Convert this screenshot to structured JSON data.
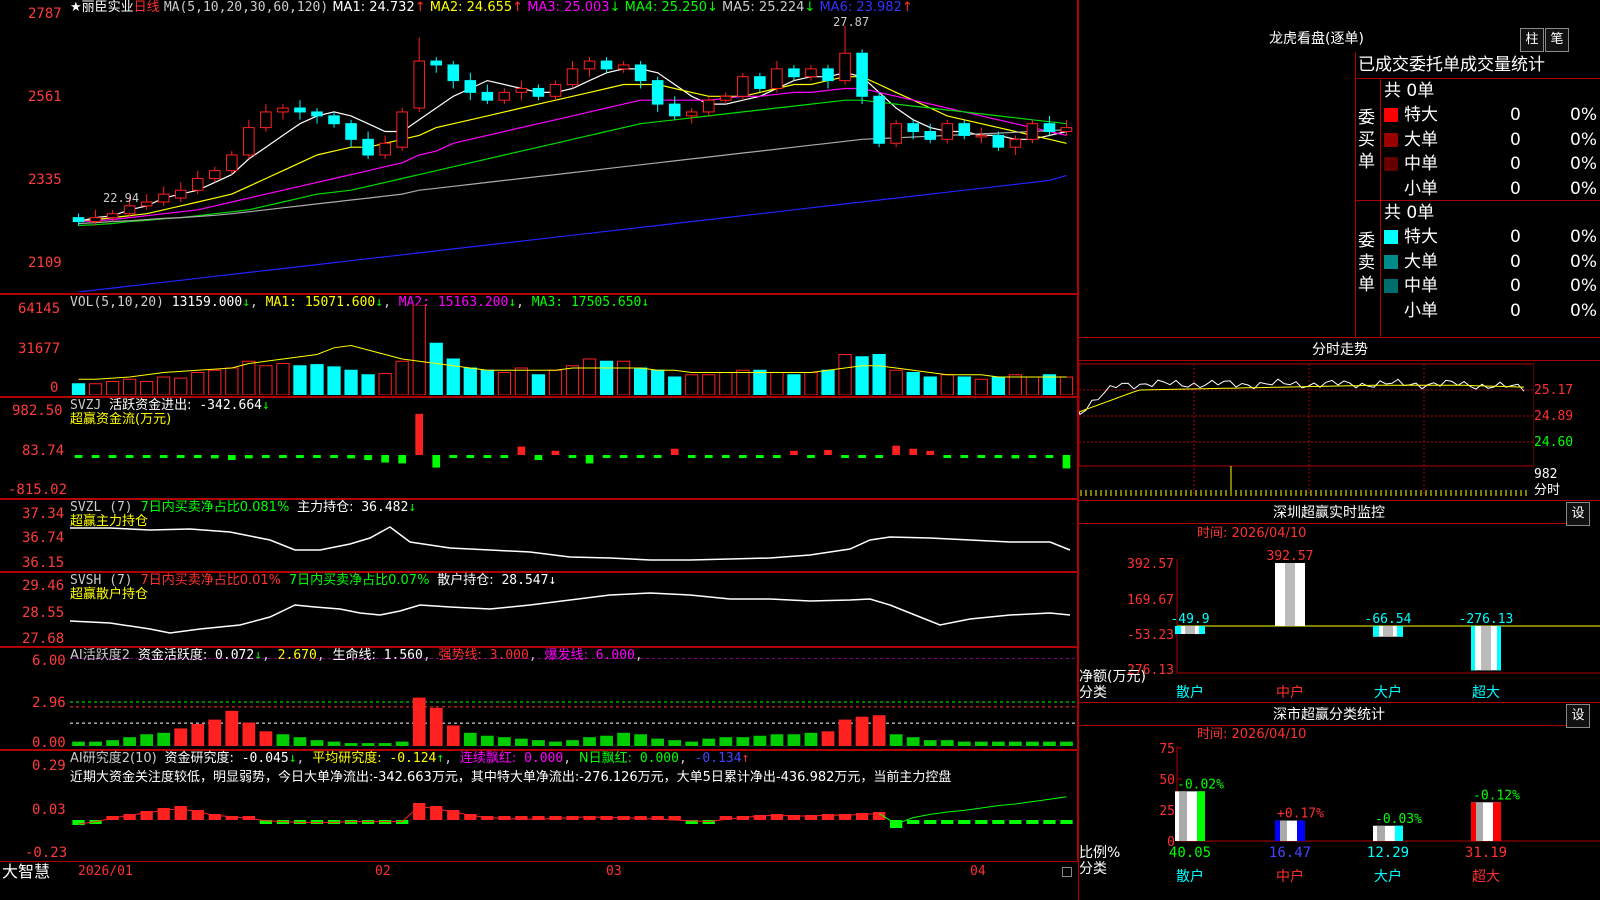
{
  "stock": {
    "name": "丽臣实业",
    "period": "日线",
    "star": "★"
  },
  "kline": {
    "axis": [
      "2787",
      "2561",
      "2335",
      "2109"
    ],
    "ma_label": "MA(5,10,20,30,60,120)",
    "ma": [
      {
        "name": "MA1:",
        "value": "24.732",
        "arrow": "↑",
        "color": "#ffffff"
      },
      {
        "name": "MA2:",
        "value": "24.655",
        "arrow": "↑",
        "color": "#ffff00"
      },
      {
        "name": "MA3:",
        "value": "25.003",
        "arrow": "↓",
        "color": "#ff00ff"
      },
      {
        "name": "MA4:",
        "value": "25.250",
        "arrow": "↓",
        "color": "#00ff00"
      },
      {
        "name": "MA5:",
        "value": "25.224",
        "arrow": "↓",
        "color": "#cccccc"
      },
      {
        "name": "MA6:",
        "value": "23.982",
        "arrow": "↑",
        "color": "#3333ff"
      }
    ],
    "high_label": "27.87",
    "low_label": "22.94",
    "colors": {
      "up": "#ff2020",
      "down": "#00ffff"
    },
    "candles": [
      [
        22.9,
        22.8,
        23.0,
        22.7
      ],
      [
        22.8,
        22.9,
        23.1,
        22.7
      ],
      [
        22.9,
        23.0,
        23.1,
        22.8
      ],
      [
        23.0,
        23.2,
        23.4,
        22.9
      ],
      [
        23.2,
        23.3,
        23.5,
        23.1
      ],
      [
        23.3,
        23.5,
        23.7,
        23.2
      ],
      [
        23.4,
        23.6,
        23.8,
        23.3
      ],
      [
        23.6,
        23.9,
        24.1,
        23.5
      ],
      [
        23.9,
        24.1,
        24.2,
        23.8
      ],
      [
        24.1,
        24.5,
        24.6,
        24.0
      ],
      [
        24.5,
        25.2,
        25.4,
        24.4
      ],
      [
        25.2,
        25.6,
        25.8,
        25.1
      ],
      [
        25.6,
        25.7,
        25.8,
        25.4
      ],
      [
        25.7,
        25.6,
        25.9,
        25.4
      ],
      [
        25.6,
        25.5,
        25.7,
        25.3
      ],
      [
        25.5,
        25.3,
        25.6,
        25.2
      ],
      [
        25.3,
        24.9,
        25.4,
        24.7
      ],
      [
        24.9,
        24.5,
        25.1,
        24.4
      ],
      [
        24.5,
        24.8,
        25.0,
        24.4
      ],
      [
        24.7,
        25.6,
        25.7,
        24.6
      ],
      [
        25.7,
        26.9,
        27.5,
        25.6
      ],
      [
        26.9,
        26.8,
        27.0,
        26.6
      ],
      [
        26.8,
        26.4,
        26.9,
        26.2
      ],
      [
        26.4,
        26.1,
        26.6,
        25.9
      ],
      [
        26.1,
        25.9,
        26.3,
        25.8
      ],
      [
        25.9,
        26.1,
        26.2,
        25.8
      ],
      [
        26.1,
        26.2,
        26.4,
        25.9
      ],
      [
        26.2,
        26.0,
        26.3,
        25.9
      ],
      [
        26.0,
        26.3,
        26.4,
        25.9
      ],
      [
        26.3,
        26.7,
        26.9,
        26.2
      ],
      [
        26.7,
        26.9,
        27.0,
        26.5
      ],
      [
        26.9,
        26.7,
        27.0,
        26.6
      ],
      [
        26.7,
        26.8,
        26.9,
        26.6
      ],
      [
        26.8,
        26.4,
        26.9,
        26.2
      ],
      [
        26.4,
        25.8,
        26.5,
        25.6
      ],
      [
        25.8,
        25.5,
        26.0,
        25.4
      ],
      [
        25.5,
        25.6,
        25.7,
        25.3
      ],
      [
        25.6,
        25.9,
        26.0,
        25.5
      ],
      [
        25.9,
        26.0,
        26.1,
        25.8
      ],
      [
        26.0,
        26.5,
        26.6,
        25.9
      ],
      [
        26.5,
        26.2,
        26.6,
        26.1
      ],
      [
        26.2,
        26.7,
        26.9,
        26.1
      ],
      [
        26.7,
        26.5,
        26.8,
        26.4
      ],
      [
        26.5,
        26.7,
        26.8,
        26.4
      ],
      [
        26.7,
        26.4,
        26.8,
        26.2
      ],
      [
        26.4,
        27.1,
        27.8,
        26.3
      ],
      [
        27.1,
        26.0,
        27.2,
        25.8
      ],
      [
        26.0,
        24.8,
        26.1,
        24.7
      ],
      [
        24.8,
        25.3,
        25.4,
        24.7
      ],
      [
        25.3,
        25.1,
        25.4,
        24.9
      ],
      [
        25.1,
        24.9,
        25.3,
        24.8
      ],
      [
        24.9,
        25.3,
        25.4,
        24.8
      ],
      [
        25.3,
        25.0,
        25.4,
        24.9
      ],
      [
        25.0,
        25.0,
        25.2,
        24.8
      ],
      [
        25.0,
        24.7,
        25.1,
        24.6
      ],
      [
        24.7,
        24.9,
        25.0,
        24.5
      ],
      [
        24.9,
        25.3,
        25.4,
        24.8
      ],
      [
        25.3,
        25.1,
        25.5,
        25.0
      ],
      [
        25.1,
        25.2,
        25.4,
        25.0
      ]
    ],
    "ma_lines": [
      {
        "color": "#ffffff",
        "v": [
          22.8,
          22.9,
          22.95,
          23.1,
          23.2,
          23.4,
          23.5,
          23.6,
          23.8,
          24.0,
          24.4,
          24.7,
          25.0,
          25.3,
          25.5,
          25.6,
          25.5,
          25.3,
          25.1,
          25.1,
          25.4,
          25.7,
          26.0,
          26.2,
          26.4,
          26.3,
          26.2,
          26.1,
          26.1,
          26.2,
          26.4,
          26.6,
          26.7,
          26.7,
          26.6,
          26.3,
          26.0,
          25.8,
          25.8,
          25.9,
          26.0,
          26.2,
          26.4,
          26.5,
          26.5,
          26.6,
          26.5,
          26.1,
          25.7,
          25.4,
          25.2,
          25.1,
          25.1,
          25.0,
          25.0,
          24.9,
          24.9,
          25.0,
          25.1
        ]
      },
      {
        "color": "#ffff00",
        "v": [
          22.8,
          22.85,
          22.9,
          22.95,
          23.0,
          23.1,
          23.2,
          23.3,
          23.4,
          23.5,
          23.7,
          23.9,
          24.1,
          24.3,
          24.5,
          24.6,
          24.7,
          24.7,
          24.8,
          24.9,
          25.0,
          25.2,
          25.3,
          25.4,
          25.5,
          25.6,
          25.7,
          25.8,
          25.9,
          26.0,
          26.1,
          26.2,
          26.3,
          26.3,
          26.3,
          26.2,
          26.1,
          26.0,
          26.0,
          26.0,
          26.1,
          26.2,
          26.3,
          26.3,
          26.4,
          26.5,
          26.5,
          26.3,
          26.1,
          25.9,
          25.7,
          25.5,
          25.4,
          25.3,
          25.2,
          25.1,
          25.0,
          24.9,
          24.8
        ]
      },
      {
        "color": "#ff00ff",
        "v": [
          22.8,
          22.82,
          22.85,
          22.9,
          22.95,
          23.0,
          23.05,
          23.1,
          23.2,
          23.3,
          23.4,
          23.5,
          23.6,
          23.7,
          23.8,
          23.9,
          24.0,
          24.1,
          24.2,
          24.3,
          24.5,
          24.6,
          24.8,
          24.9,
          25.0,
          25.1,
          25.2,
          25.3,
          25.4,
          25.5,
          25.6,
          25.7,
          25.8,
          25.9,
          25.9,
          25.9,
          25.9,
          25.9,
          25.95,
          26.0,
          26.0,
          26.05,
          26.1,
          26.1,
          26.15,
          26.2,
          26.2,
          26.1,
          26.0,
          25.9,
          25.8,
          25.7,
          25.6,
          25.5,
          25.4,
          25.3,
          25.2,
          25.1,
          25.0
        ]
      },
      {
        "color": "#00dd00",
        "v": [
          22.7,
          22.72,
          22.75,
          22.8,
          22.83,
          22.87,
          22.9,
          22.95,
          23.0,
          23.05,
          23.1,
          23.2,
          23.3,
          23.4,
          23.5,
          23.55,
          23.6,
          23.7,
          23.8,
          23.9,
          24.0,
          24.1,
          24.2,
          24.3,
          24.4,
          24.5,
          24.6,
          24.7,
          24.8,
          24.9,
          25.0,
          25.1,
          25.2,
          25.3,
          25.35,
          25.4,
          25.45,
          25.5,
          25.55,
          25.6,
          25.65,
          25.7,
          25.75,
          25.8,
          25.85,
          25.9,
          25.9,
          25.85,
          25.8,
          25.75,
          25.7,
          25.65,
          25.6,
          25.55,
          25.5,
          25.45,
          25.4,
          25.35,
          25.3
        ]
      },
      {
        "color": "#aaaaaa",
        "v": [
          22.75,
          22.77,
          22.8,
          22.82,
          22.85,
          22.88,
          22.9,
          22.93,
          22.96,
          23.0,
          23.05,
          23.1,
          23.15,
          23.2,
          23.25,
          23.3,
          23.35,
          23.4,
          23.45,
          23.5,
          23.6,
          23.65,
          23.7,
          23.75,
          23.8,
          23.85,
          23.9,
          23.95,
          24.0,
          24.05,
          24.1,
          24.15,
          24.2,
          24.25,
          24.3,
          24.35,
          24.4,
          24.45,
          24.5,
          24.55,
          24.6,
          24.65,
          24.7,
          24.75,
          24.8,
          24.85,
          24.9,
          24.92,
          24.94,
          24.96,
          24.98,
          25.0,
          25.02,
          25.04,
          25.06,
          25.08,
          25.1,
          25.12,
          25.15
        ]
      },
      {
        "color": "#2222ff",
        "v": [
          21.0,
          21.05,
          21.1,
          21.15,
          21.2,
          21.25,
          21.3,
          21.35,
          21.4,
          21.45,
          21.5,
          21.55,
          21.6,
          21.65,
          21.7,
          21.75,
          21.8,
          21.85,
          21.9,
          21.95,
          22.0,
          22.05,
          22.1,
          22.15,
          22.2,
          22.25,
          22.3,
          22.35,
          22.4,
          22.45,
          22.5,
          22.55,
          22.6,
          22.65,
          22.7,
          22.75,
          22.8,
          22.85,
          22.9,
          22.95,
          23.0,
          23.05,
          23.1,
          23.15,
          23.2,
          23.25,
          23.3,
          23.35,
          23.4,
          23.45,
          23.5,
          23.55,
          23.6,
          23.65,
          23.7,
          23.75,
          23.8,
          23.85,
          23.98
        ]
      }
    ]
  },
  "vol": {
    "axis": [
      "64145",
      "31677",
      "0"
    ],
    "label": "VOL(5,10,20)",
    "items": [
      {
        "t": "13159.000",
        "a": "↓",
        "c": "#ffffff"
      },
      {
        "t": "MA1: 15071.600",
        "a": "↓",
        "c": "#ffff00"
      },
      {
        "t": "MA2: 15163.200",
        "a": "↓",
        "c": "#ff00ff"
      },
      {
        "t": "MA3: 17505.650",
        "a": "↓",
        "c": "#00ff00"
      }
    ],
    "bars": [
      10,
      10,
      12,
      14,
      12,
      16,
      15,
      20,
      22,
      24,
      30,
      26,
      28,
      26,
      27,
      25,
      22,
      18,
      19,
      30,
      80,
      46,
      32,
      24,
      22,
      20,
      24,
      18,
      22,
      26,
      32,
      30,
      30,
      24,
      22,
      16,
      18,
      18,
      20,
      22,
      22,
      20,
      18,
      20,
      22,
      36,
      34,
      36,
      22,
      20,
      16,
      18,
      16,
      14,
      16,
      18,
      16,
      18,
      16
    ],
    "ma": [
      [
        14,
        14,
        15,
        16,
        18,
        20,
        21,
        22,
        23,
        24,
        28,
        30,
        32,
        34,
        36,
        42,
        44,
        40,
        36,
        32,
        30,
        28,
        26,
        24,
        22,
        22,
        22,
        22,
        22,
        24,
        24,
        24,
        24,
        24,
        22,
        22,
        20,
        20,
        20,
        20,
        20,
        20,
        20,
        20,
        22,
        24,
        26,
        26,
        24,
        22,
        20,
        18,
        18,
        18,
        16,
        16,
        16,
        16,
        16
      ]
    ]
  },
  "svzj": {
    "axis": [
      "982.50",
      "83.74",
      "-815.02"
    ],
    "label": "SVZJ",
    "title": "活跃资金进出:",
    "value": "-342.664",
    "arrow": "↓",
    "subtitle": "超赢资金流(万元)",
    "values": [
      -20,
      -20,
      -20,
      -20,
      -20,
      -20,
      -40,
      -60,
      -80,
      -120,
      -80,
      -40,
      -20,
      -30,
      -40,
      -60,
      -80,
      -120,
      -180,
      -240,
      -360,
      -60,
      -40,
      -20,
      -30,
      -40,
      -60,
      -120,
      -80,
      -20,
      -30,
      -20,
      -20,
      -20,
      -10,
      -10,
      -10,
      -10,
      -20,
      -30,
      -20,
      -10,
      -20,
      -20,
      -20,
      -10,
      -10,
      -10,
      -20,
      -30,
      -20,
      -20,
      -20,
      -20,
      -20,
      -20,
      -20,
      -20,
      -320
    ],
    "extra": [
      [
        20,
        980
      ],
      [
        19,
        -200
      ],
      [
        21,
        -300
      ],
      [
        26,
        200
      ],
      [
        28,
        100
      ],
      [
        30,
        -200
      ],
      [
        35,
        150
      ],
      [
        42,
        100
      ],
      [
        44,
        120
      ],
      [
        48,
        220
      ],
      [
        49,
        150
      ],
      [
        50,
        100
      ],
      [
        55,
        -80
      ]
    ]
  },
  "svzl": {
    "axis": [
      "37.34",
      "36.74",
      "36.15"
    ],
    "label": "SVZL",
    "param": "(7)",
    "desc": "7日内买卖净占比0.081%",
    "title": "主力持仓:",
    "value": "36.482",
    "arrow": "↓",
    "subtitle": "超赢主力持仓"
  },
  "svsh": {
    "axis": [
      "29.46",
      "28.55",
      "27.68"
    ],
    "label": "SVSH",
    "param": "(7)",
    "desc1": "7日内买卖净占比0.01%",
    "desc2": "7日内买卖净占比0.07%",
    "title": "散户持仓:",
    "value": "28.547",
    "arrow": "↓",
    "subtitle": "超赢散户持仓"
  },
  "ai1": {
    "axis": [
      "6.00",
      "2.96",
      "0.00"
    ],
    "label": "AI活跃度2",
    "title": "资金活跃度:",
    "value": "0.072",
    "arrow": "↓",
    "v2": "2.670",
    "life": "生命线:",
    "life_v": "1.560",
    "strong": "强势线:",
    "strong_v": "3.000",
    "burst": "爆发线:",
    "burst_v": "6.000",
    "values": [
      0.3,
      0.3,
      0.4,
      0.6,
      0.8,
      0.9,
      1.2,
      1.5,
      1.8,
      2.4,
      1.6,
      1.0,
      0.8,
      0.6,
      0.4,
      0.3,
      0.2,
      0.2,
      0.2,
      0.3,
      3.3,
      2.6,
      1.4,
      0.9,
      0.7,
      0.6,
      0.5,
      0.4,
      0.3,
      0.4,
      0.6,
      0.7,
      0.9,
      0.8,
      0.5,
      0.4,
      0.3,
      0.5,
      0.6,
      0.6,
      0.7,
      0.8,
      0.8,
      0.9,
      1.0,
      1.8,
      2.0,
      2.1,
      0.8,
      0.6,
      0.4,
      0.4,
      0.3,
      0.3,
      0.3,
      0.3,
      0.3,
      0.3,
      0.3
    ]
  },
  "ai2": {
    "axis": [
      "0.29",
      "0.03",
      "-0.23"
    ],
    "label": "AI研究度2(10)",
    "title": "资金研究度:",
    "value": "-0.045",
    "arrow": "↓",
    "avg": "平均研究度:",
    "avg_v": "-0.124",
    "lh": "连续飘红:",
    "lh_v": "0.000",
    "nh": "N日飘红:",
    "nh_v": "0.000",
    "last": "-0.134",
    "text": "近期大资金关注度较低，明显弱势，今日大单净流出:-342.663万元，其中特大单净流出:-276.126万元，大单5日累计净出-436.982万元，当前主力控盘",
    "bars": [
      -0.05,
      -0.02,
      0.02,
      0.06,
      0.09,
      0.12,
      0.14,
      0.1,
      0.06,
      0.04,
      0.02,
      -0.01,
      -0.02,
      -0.03,
      -0.03,
      -0.03,
      -0.02,
      -0.02,
      -0.02,
      -0.02,
      0.17,
      0.14,
      0.1,
      0.06,
      0.03,
      0.02,
      0.01,
      0.01,
      0.02,
      0.03,
      0.04,
      0.03,
      0.03,
      0.02,
      0.01,
      0.0,
      -0.01,
      -0.02,
      0.01,
      0.03,
      0.05,
      0.06,
      0.05,
      0.05,
      0.06,
      0.06,
      0.07,
      0.08,
      -0.08,
      -0.03,
      -0.02,
      -0.02,
      -0.03,
      -0.03,
      -0.03,
      -0.04,
      -0.04,
      -0.04,
      -0.04
    ]
  },
  "xaxis": {
    "ticks": [
      "2026/01",
      "02",
      "03",
      "04"
    ],
    "brand": "大智慧"
  },
  "lhb": {
    "title": "龙虎看盘(逐单)",
    "btn1": "柱",
    "btn2": "笔",
    "header": "已成交委托单成交量统计",
    "buy_side": "委买单",
    "sell_side": "委卖单",
    "buy_total": "共 0单",
    "sell_total": "共 0单",
    "buy_rows": [
      {
        "label": "特大",
        "count": "0",
        "pct": "0%",
        "color": "#ff0000"
      },
      {
        "label": "大单",
        "count": "0",
        "pct": "0%",
        "color": "#990000"
      },
      {
        "label": "中单",
        "count": "0",
        "pct": "0%",
        "color": "#660000"
      },
      {
        "label": "小单",
        "count": "0",
        "pct": "0%",
        "color": "#000000"
      }
    ],
    "sell_rows": [
      {
        "label": "特大",
        "count": "0",
        "pct": "0%",
        "color": "#00ffff"
      },
      {
        "label": "大单",
        "count": "0",
        "pct": "0%",
        "color": "#008b8b"
      },
      {
        "label": "中单",
        "count": "0",
        "pct": "0%",
        "color": "#006d6d"
      },
      {
        "label": "小单",
        "count": "0",
        "pct": "0%",
        "color": "#000000"
      }
    ]
  },
  "intraday": {
    "title": "分时走势",
    "axis": [
      "25.17",
      "24.89",
      "24.60",
      "982"
    ],
    "unit": "分时"
  },
  "monitor": {
    "title": "深圳超赢实时监控",
    "btn": "设",
    "time": "时间: 2026/04/10",
    "axis": [
      "392.57",
      "169.67",
      "-53.23",
      "-276.13"
    ],
    "ylabel": "净额(万元)",
    "xlabel": "分类",
    "cats": [
      "散户",
      "中户",
      "大户",
      "超大"
    ],
    "values": [
      "-49.9",
      "392.57",
      "-66.54",
      "-276.13"
    ],
    "colors": [
      "#ffffff",
      "#cccccc",
      "#00ffff",
      "#00ffff"
    ]
  },
  "classify": {
    "title": "深市超赢分类统计",
    "btn": "设",
    "time": "时间: 2026/04/10",
    "axis": [
      "75",
      "50",
      "25",
      "0"
    ],
    "ylabel": "比例%",
    "xlabel": "分类",
    "cats": [
      "散户",
      "中户",
      "大户",
      "超大"
    ],
    "values": [
      "40.05",
      "16.47",
      "12.29",
      "31.19"
    ],
    "changes": [
      "-0.02%",
      "+0.17%",
      "-0.03%",
      "-0.12%"
    ],
    "colors": [
      "#00ff00",
      "#0000ff",
      "#00ffff",
      "#ff0000"
    ]
  }
}
